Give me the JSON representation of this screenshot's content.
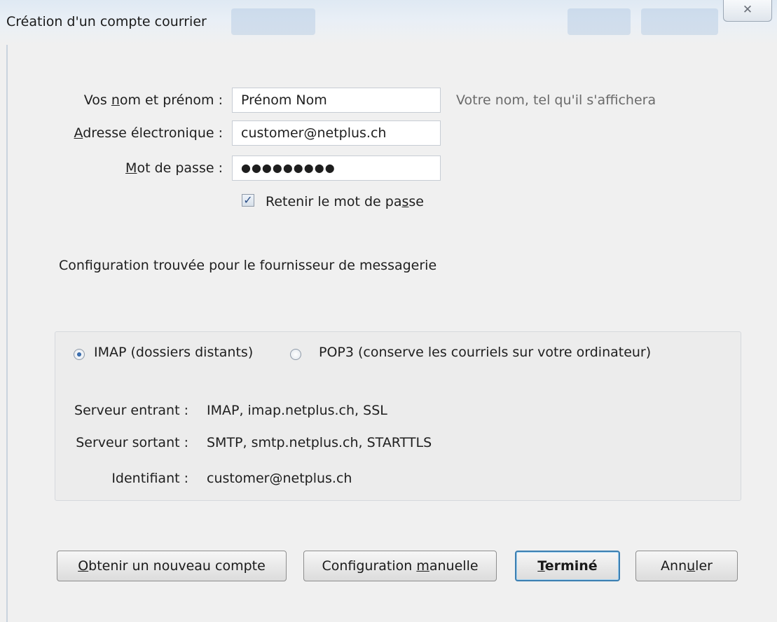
{
  "window": {
    "title": "Création d'un compte courrier",
    "close_glyph": "✕"
  },
  "form": {
    "name_label_pre": "Vos ",
    "name_label_key": "n",
    "name_label_post": "om et prénom :",
    "name_value": "Prénom Nom",
    "name_hint": "Votre nom, tel qu'il s'affichera",
    "email_label_key": "A",
    "email_label_post": "dresse électronique :",
    "email_value": "customer@netplus.ch",
    "password_label_key": "M",
    "password_label_post": "ot de passe :",
    "password_value": "●●●●●●●●●",
    "remember_label_pre": "Retenir le mot de pa",
    "remember_label_key": "s",
    "remember_label_post": "se",
    "remember_checked": true,
    "checkmark": "✓"
  },
  "status": {
    "config_found": "Configuration trouvée pour le fournisseur de messagerie"
  },
  "protocol": {
    "imap_label": "IMAP (dossiers distants)",
    "pop3_label": "POP3 (conserve les courriels sur votre ordinateur)",
    "selected": "IMAP"
  },
  "server_info": [
    {
      "label": "Serveur entrant :",
      "value": "IMAP, imap.netplus.ch, SSL"
    },
    {
      "label": "Serveur sortant :",
      "value": "SMTP, smtp.netplus.ch, STARTTLS"
    },
    {
      "label": "Identifiant :",
      "value": "customer@netplus.ch"
    }
  ],
  "buttons": {
    "new_account_key": "O",
    "new_account_post": "btenir un nouveau compte",
    "manual_pre": "Configuration ",
    "manual_key": "m",
    "manual_post": "anuelle",
    "done_key": "T",
    "done_post": "erminé",
    "cancel_pre": "Ann",
    "cancel_key": "u",
    "cancel_post": "ler"
  }
}
